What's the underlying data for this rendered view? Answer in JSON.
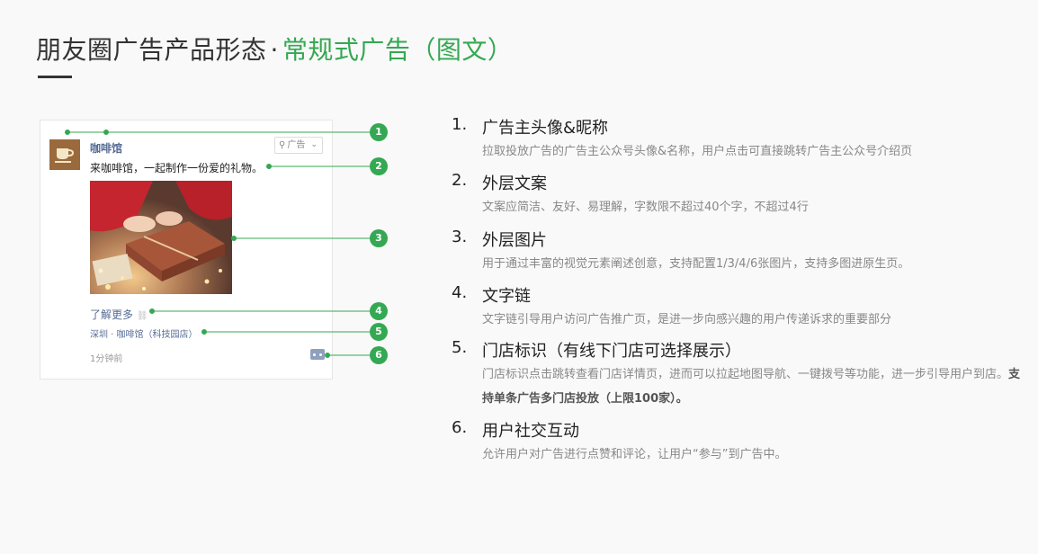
{
  "title": {
    "main": "朋友圈广告产品形态",
    "separator": "·",
    "highlight": "常规式广告（图文）"
  },
  "ad_preview": {
    "nickname": "咖啡馆",
    "ad_tag": "广告",
    "copy": "来咖啡馆，一起制作一份爱的礼物。",
    "link_text": "了解更多",
    "store_label": "深圳 · 咖啡馆（科技园店）",
    "time": "1分钟前"
  },
  "callouts": [
    "1",
    "2",
    "3",
    "4",
    "5",
    "6"
  ],
  "features": [
    {
      "num": "1.",
      "title": "广告主头像&昵称",
      "desc": "拉取投放广告的广告主公众号头像&名称，用户点击可直接跳转广告主公众号介绍页"
    },
    {
      "num": "2.",
      "title": "外层文案",
      "desc": "文案应简洁、友好、易理解，字数限不超过40个字，不超过4行"
    },
    {
      "num": "3.",
      "title": "外层图片",
      "desc": "用于通过丰富的视觉元素阐述创意，支持配置1/3/4/6张图片，支持多图进原生页。"
    },
    {
      "num": "4.",
      "title": "文字链",
      "desc": "文字链引导用户访问广告推广页，是进一步向感兴趣的用户传递诉求的重要部分"
    },
    {
      "num": "5.",
      "title": "门店标识（有线下门店可选择展示）",
      "desc": "门店标识点击跳转查看门店详情页，进而可以拉起地图导航、一键拨号等功能，进一步引导用户到店。",
      "desc_bold": "支持单条广告多门店投放（上限100家）。"
    },
    {
      "num": "6.",
      "title": "用户社交互动",
      "desc": "允许用户对广告进行点赞和评论，让用户“参与”到广告中。"
    }
  ],
  "colors": {
    "accent": "#34a852",
    "link": "#576b95",
    "text": "#222222",
    "muted": "#888888"
  }
}
